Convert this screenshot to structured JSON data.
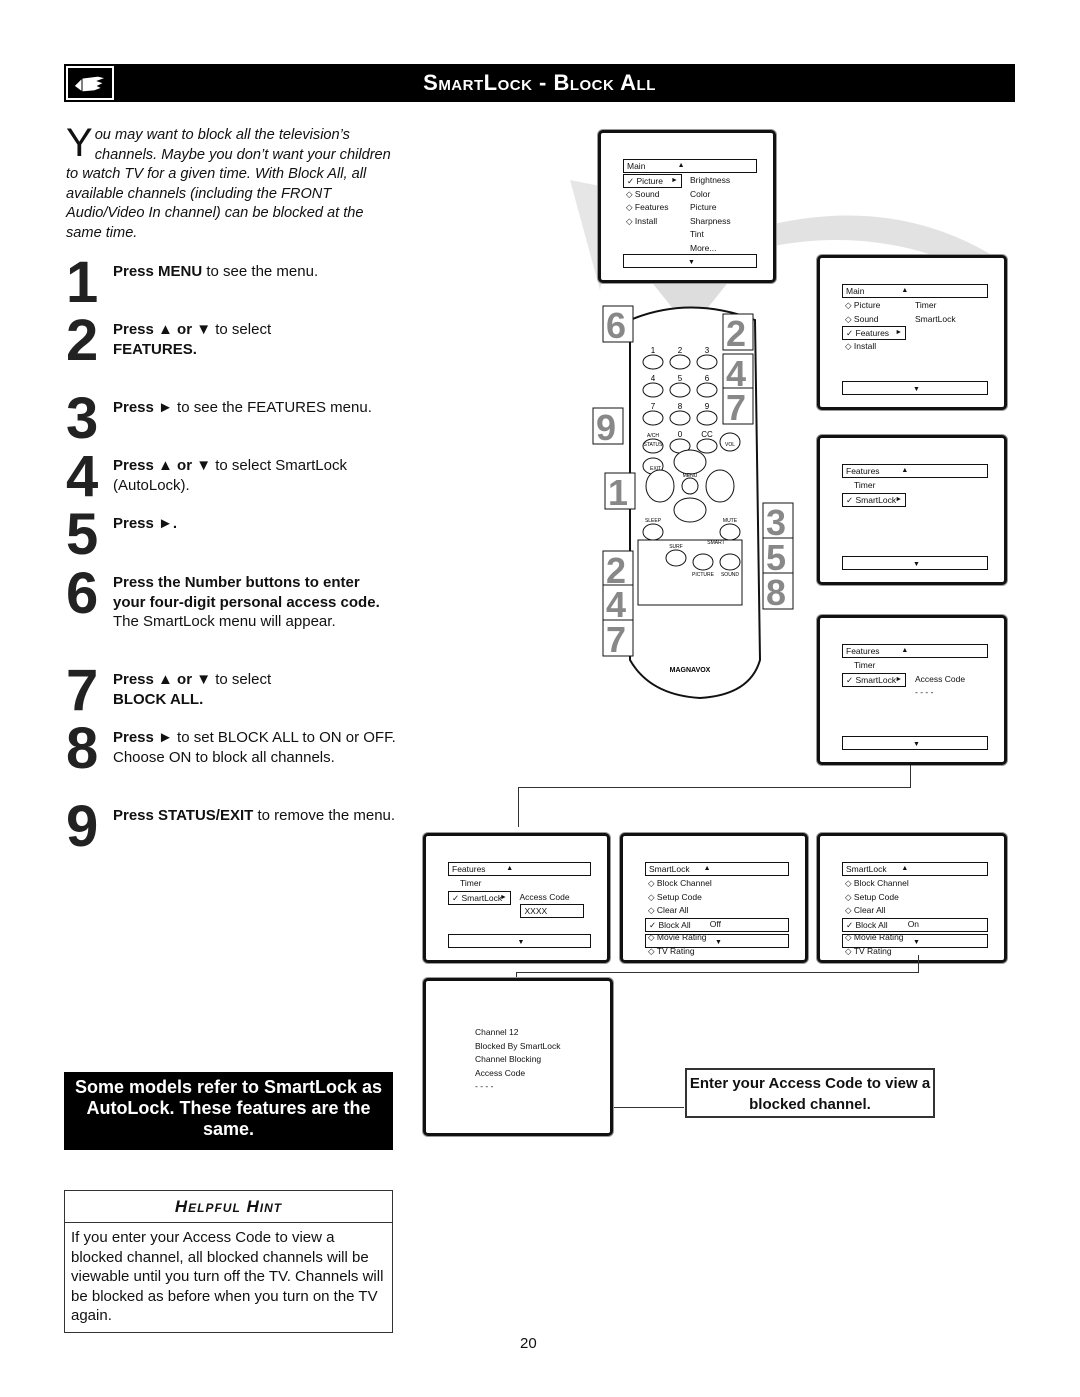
{
  "header": {
    "title": "SmartLock - Block All",
    "icon": "hand-pointing-icon"
  },
  "intro": {
    "drop": "Y",
    "text": "ou may want to block all the television’s channels. Maybe you don’t want your children to watch TV for a given time. With Block All, all available channels (including the FRONT Audio/Video In channel) can be blocked at the same time."
  },
  "steps": [
    {
      "n": "1",
      "bold": "Press MENU",
      "text": " to see the menu."
    },
    {
      "n": "2",
      "bold": "Press ▲ or ▼",
      "text": " to select",
      "bold2": "FEATURES."
    },
    {
      "n": "3",
      "bold": "Press ►",
      "text": " to see the FEATURES menu."
    },
    {
      "n": "4",
      "bold": "Press ▲ or ▼",
      "text": " to select SmartLock (AutoLock)."
    },
    {
      "n": "5",
      "bold": "Press ►.",
      "text": ""
    },
    {
      "n": "6",
      "bold": "Press the Number buttons to enter your four-digit personal access code.",
      "text": " The SmartLock menu will appear."
    },
    {
      "n": "7",
      "bold": "Press ▲ or ▼",
      "text": " to select ",
      "bold2": "BLOCK ALL."
    },
    {
      "n": "8",
      "bold": "Press ►",
      "text": " to set BLOCK ALL to ON or OFF.  Choose ON to block all channels."
    },
    {
      "n": "9",
      "bold": "Press STATUS/EXIT",
      "text": " to remove the menu."
    }
  ],
  "note": "Some models refer to SmartLock as AutoLock. These features are the same.",
  "hint": {
    "title": "Helpful Hint",
    "body": "If you enter your Access Code to view a blocked channel,  all blocked channels will be viewable until you turn off the TV. Channels will be blocked as before when you turn on the TV again."
  },
  "page_number": "20",
  "callout": "Enter your Access Code to view a blocked channel.",
  "remote": {
    "brand": "MAGNAVOX",
    "keys": [
      "1",
      "2",
      "3",
      "4",
      "5",
      "6",
      "7",
      "8",
      "9",
      "A/CH",
      "0",
      "CC",
      "STATUS",
      "EXIT",
      "VOL",
      "MENU",
      "SLEEP",
      "MUTE",
      "SURF",
      "SMART",
      "PICTURE",
      "SOUND"
    ],
    "step_labels_left": [
      "6",
      "9",
      "1",
      "2",
      "4",
      "7"
    ],
    "step_labels_right": [
      "2",
      "4",
      "7",
      "3",
      "5",
      "8"
    ]
  },
  "menus": [
    {
      "title": "Main",
      "rows": [
        [
          "check",
          "Picture",
          true,
          "Brightness"
        ],
        [
          "diamond",
          "Sound",
          false,
          "Color"
        ],
        [
          "diamond",
          "Features",
          false,
          "Picture"
        ],
        [
          "diamond",
          "Install",
          false,
          "Sharpness"
        ],
        [
          "",
          "",
          false,
          "Tint"
        ],
        [
          "",
          "",
          false,
          "More..."
        ]
      ]
    },
    {
      "title": "Main",
      "rows": [
        [
          "diamond",
          "Picture",
          false,
          "Timer"
        ],
        [
          "diamond",
          "Sound",
          false,
          "SmartLock"
        ],
        [
          "check",
          "Features",
          true,
          ""
        ],
        [
          "diamond",
          "Install",
          false,
          ""
        ]
      ]
    },
    {
      "title": "Features",
      "rows": [
        [
          "",
          "Timer",
          false,
          ""
        ],
        [
          "check",
          "SmartLock",
          true,
          ""
        ]
      ]
    },
    {
      "title": "Features",
      "rows": [
        [
          "",
          "Timer",
          false,
          ""
        ],
        [
          "check",
          "SmartLock",
          true,
          "Access Code"
        ],
        [
          "",
          "",
          false,
          "- - - -"
        ]
      ]
    },
    {
      "title": "Features",
      "rows": [
        [
          "",
          "Timer",
          false,
          ""
        ],
        [
          "check",
          "SmartLock",
          true,
          "Access Code"
        ],
        [
          "",
          "",
          false,
          "XXXX"
        ]
      ]
    },
    {
      "title": "SmartLock",
      "rows": [
        [
          "diamond",
          "Block Channel",
          false,
          ""
        ],
        [
          "diamond",
          "Setup Code",
          false,
          ""
        ],
        [
          "diamond",
          "Clear All",
          false,
          ""
        ],
        [
          "check",
          "Block All",
          true,
          "Off"
        ],
        [
          "diamond",
          "Movie Rating",
          false,
          ""
        ],
        [
          "diamond",
          "TV Rating",
          false,
          ""
        ]
      ]
    },
    {
      "title": "SmartLock",
      "rows": [
        [
          "diamond",
          "Block Channel",
          false,
          ""
        ],
        [
          "diamond",
          "Setup Code",
          false,
          ""
        ],
        [
          "diamond",
          "Clear All",
          false,
          ""
        ],
        [
          "check",
          "Block All",
          true,
          "On"
        ],
        [
          "diamond",
          "Movie Rating",
          false,
          ""
        ],
        [
          "diamond",
          "TV Rating",
          false,
          ""
        ]
      ]
    }
  ],
  "final_screen": [
    "Channel 12",
    "Blocked By SmartLock",
    "Channel Blocking",
    "Access Code",
    "- - - -"
  ]
}
